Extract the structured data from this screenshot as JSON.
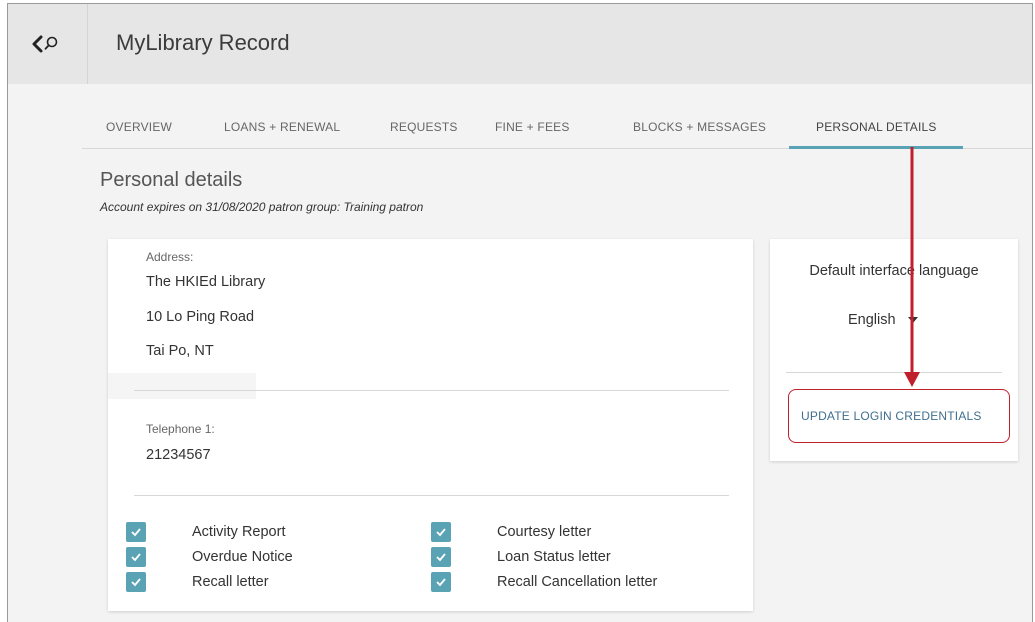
{
  "header": {
    "title": "MyLibrary Record",
    "back_icon": "chevron-left-icon",
    "search_icon": "search-icon"
  },
  "tabs": [
    {
      "label": "OVERVIEW"
    },
    {
      "label": "LOANS + RENEWAL"
    },
    {
      "label": "REQUESTS"
    },
    {
      "label": "FINE + FEES"
    },
    {
      "label": "BLOCKS + MESSAGES"
    },
    {
      "label": "PERSONAL DETAILS",
      "active": true
    }
  ],
  "section": {
    "title": "Personal details",
    "subtitle": "Account expires on 31/08/2020 patron group: Training patron"
  },
  "address": {
    "label": "Address:",
    "lines": [
      "The HKIEd Library",
      "10 Lo Ping Road",
      "Tai Po, NT"
    ]
  },
  "telephone": {
    "label": "Telephone 1:",
    "value": "21234567"
  },
  "notifications": [
    {
      "label": "Activity Report",
      "checked": true
    },
    {
      "label": "Courtesy letter",
      "checked": true
    },
    {
      "label": "Overdue Notice",
      "checked": true
    },
    {
      "label": "Loan Status letter",
      "checked": true
    },
    {
      "label": "Recall letter",
      "checked": true
    },
    {
      "label": "Recall Cancellation letter",
      "checked": true
    }
  ],
  "language": {
    "label": "Default interface language",
    "selected": "English"
  },
  "update_button": {
    "label": "UPDATE LOGIN CREDENTIALS"
  },
  "colors": {
    "accent": "#5aa3b5",
    "annotation": "#c0202c",
    "link": "#3f6f8f"
  }
}
